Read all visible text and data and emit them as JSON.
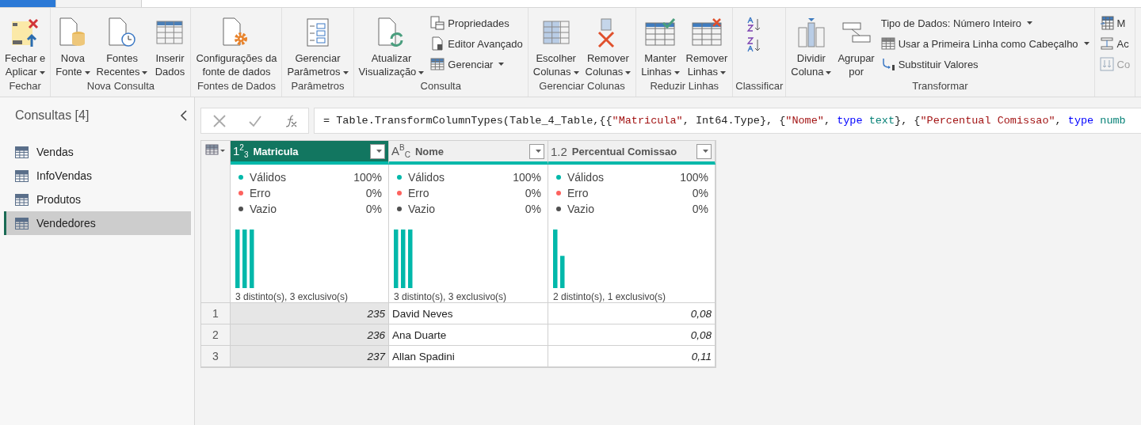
{
  "ribbon_tabs": [
    {
      "kind": "file",
      "selected": false
    },
    {
      "kind": "normal",
      "selected": true
    }
  ],
  "ribbon": {
    "groups": [
      {
        "label": "Fechar",
        "items": [
          {
            "kind": "large",
            "lines": [
              "Fechar e",
              "Aplicar"
            ],
            "dropdown": true
          }
        ]
      },
      {
        "label": "Nova Consulta",
        "items": [
          {
            "kind": "large",
            "lines": [
              "Nova",
              "Fonte"
            ],
            "dropdown": true
          },
          {
            "kind": "large",
            "lines": [
              "Fontes",
              "Recentes"
            ],
            "dropdown": true
          },
          {
            "kind": "large",
            "lines": [
              "Inserir",
              "Dados"
            ],
            "dropdown": false
          }
        ]
      },
      {
        "label": "Fontes de Dados",
        "items": [
          {
            "kind": "large",
            "lines": [
              "Configurações da",
              "fonte de dados"
            ],
            "dropdown": false
          }
        ]
      },
      {
        "label": "Parâmetros",
        "items": [
          {
            "kind": "large",
            "lines": [
              "Gerenciar",
              "Parâmetros"
            ],
            "dropdown": true
          }
        ]
      },
      {
        "label": "Consulta",
        "items": [
          {
            "kind": "large",
            "lines": [
              "Atualizar",
              "Visualização"
            ],
            "dropdown": true
          },
          {
            "kind": "stack",
            "items": [
              {
                "label": "Propriedades",
                "dropdown": false
              },
              {
                "label": "Editor Avançado",
                "dropdown": false
              },
              {
                "label": "Gerenciar",
                "dropdown": true
              }
            ]
          }
        ]
      },
      {
        "label": "Gerenciar Colunas",
        "items": [
          {
            "kind": "large",
            "lines": [
              "Escolher",
              "Colunas"
            ],
            "dropdown": true
          },
          {
            "kind": "large",
            "lines": [
              "Remover",
              "Colunas"
            ],
            "dropdown": true
          }
        ]
      },
      {
        "label": "Reduzir Linhas",
        "items": [
          {
            "kind": "large",
            "lines": [
              "Manter",
              "Linhas"
            ],
            "dropdown": true
          },
          {
            "kind": "large",
            "lines": [
              "Remover",
              "Linhas"
            ],
            "dropdown": true
          }
        ]
      },
      {
        "label": "Classificar",
        "items": [
          {
            "kind": "iconstack"
          }
        ]
      },
      {
        "label": "Transformar",
        "items": [
          {
            "kind": "large",
            "lines": [
              "Dividir",
              "Coluna"
            ],
            "dropdown": true
          },
          {
            "kind": "large",
            "lines": [
              "Agrupar",
              "por"
            ],
            "dropdown": false
          },
          {
            "kind": "stack",
            "items": [
              {
                "label": "Tipo de Dados: Número Inteiro",
                "dropdown": true
              },
              {
                "label": "Usar a Primeira Linha como Cabeçalho",
                "dropdown": true
              },
              {
                "label": "Substituir Valores",
                "dropdown": false
              }
            ]
          }
        ]
      },
      {
        "items": [
          {
            "kind": "stack",
            "items": [
              {
                "label": "M",
                "dropdown": false,
                "disabled": false
              },
              {
                "label": "Ac",
                "dropdown": false,
                "disabled": false
              },
              {
                "label": "Co",
                "dropdown": false,
                "disabled": true
              }
            ]
          }
        ]
      }
    ]
  },
  "queries": {
    "title": "Consultas [4]",
    "items": [
      {
        "label": "Vendas",
        "selected": false
      },
      {
        "label": "InfoVendas",
        "selected": false
      },
      {
        "label": "Produtos",
        "selected": false
      },
      {
        "label": "Vendedores",
        "selected": true
      }
    ]
  },
  "formula": {
    "tokens": [
      {
        "kind": "plain",
        "text": "= Table.TransformColumnTypes(Table_4_Table,{{"
      },
      {
        "kind": "string",
        "text": "\"Matricula\""
      },
      {
        "kind": "plain",
        "text": ", Int64.Type}, {"
      },
      {
        "kind": "string",
        "text": "\"Nome\""
      },
      {
        "kind": "plain",
        "text": ", "
      },
      {
        "kind": "keyword",
        "text": "type"
      },
      {
        "kind": "typename",
        "text": " text"
      },
      {
        "kind": "plain",
        "text": "}, {"
      },
      {
        "kind": "string",
        "text": "\"Percentual Comissao\""
      },
      {
        "kind": "plain",
        "text": ", "
      },
      {
        "kind": "keyword",
        "text": "type"
      },
      {
        "kind": "typename",
        "text": " numb"
      }
    ]
  },
  "table": {
    "columns": [
      {
        "name": "Matricula",
        "type_label": "1$^{2}$$_{3}$",
        "kind": "number",
        "selected": true,
        "quality": [
          {
            "label": "Válidos",
            "value": "100%",
            "color": "#01b8aa"
          },
          {
            "label": "Erro",
            "value": "0%",
            "color": "#fd625e"
          },
          {
            "label": "Vazio",
            "value": "0%",
            "color": "#505050"
          }
        ],
        "summary": "3 distinto(s), 3 exclusivo(s)"
      },
      {
        "name": "Nome",
        "type_label": "A$^{B}$$_{C}$",
        "kind": "text",
        "selected": false,
        "quality": [
          {
            "label": "Válidos",
            "value": "100%",
            "color": "#01b8aa"
          },
          {
            "label": "Erro",
            "value": "0%",
            "color": "#fd625e"
          },
          {
            "label": "Vazio",
            "value": "0%",
            "color": "#505050"
          }
        ],
        "summary": "3 distinto(s), 3 exclusivo(s)"
      },
      {
        "name": "Percentual Comissao",
        "type_label": "1.2",
        "kind": "number",
        "selected": false,
        "quality": [
          {
            "label": "Válidos",
            "value": "100%",
            "color": "#01b8aa"
          },
          {
            "label": "Erro",
            "value": "0%",
            "color": "#fd625e"
          },
          {
            "label": "Vazio",
            "value": "0%",
            "color": "#505050"
          }
        ],
        "summary": "2 distinto(s), 1 exclusivo(s)"
      }
    ],
    "rows": [
      {
        "number": "1",
        "cells": [
          "235",
          "David Neves",
          "0,08"
        ]
      },
      {
        "number": "2",
        "cells": [
          "236",
          "Ana Duarte",
          "0,08"
        ]
      },
      {
        "number": "3",
        "cells": [
          "237",
          "Allan Spadini",
          "0,11"
        ]
      }
    ]
  }
}
